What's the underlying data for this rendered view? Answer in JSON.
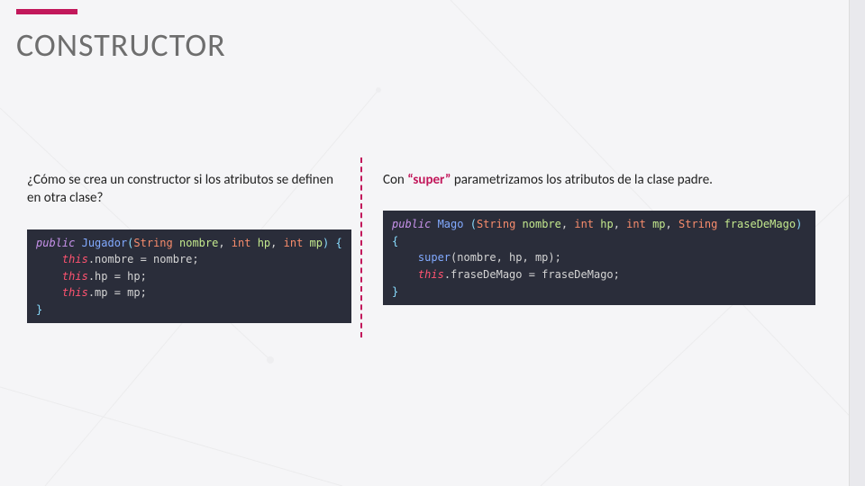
{
  "title": "CONSTRUCTOR",
  "left": {
    "question": "¿Cómo se crea un constructor si los atributos se definen en otra clase?",
    "code": {
      "l1_public": "public",
      "l1_name": "Jugador",
      "l1_sig_a": "(",
      "l1_t1": "String",
      "l1_p1": " nombre",
      "l1_c1": ", ",
      "l1_t2": "int",
      "l1_p2": " hp",
      "l1_c2": ", ",
      "l1_t3": "int",
      "l1_p3": " mp",
      "l1_sig_b": ")",
      "l1_brace": " {",
      "l2_this": "this",
      "l2_rest": ".nombre = nombre;",
      "l3_this": "this",
      "l3_rest": ".hp = hp;",
      "l4_this": "this",
      "l4_rest": ".mp = mp;",
      "l5": "}"
    }
  },
  "right": {
    "pre": "Con ",
    "super": "“super”",
    "post": " parametrizamos los atributos de la clase padre.",
    "code": {
      "l1_public": "public",
      "l1_name": " Mago ",
      "l1_open": "(",
      "l1_t1": "String",
      "l1_p1": " nombre",
      "l1_c1": ", ",
      "l1_t2": "int",
      "l1_p2": " hp",
      "l1_c2": ", ",
      "l1_t3": "int",
      "l1_p3": " mp",
      "l1_c3": ", ",
      "l1_t4": "String",
      "l1_p4": " fraseDeMago",
      "l1_close": ")",
      "l2": "{",
      "l3_super": "super",
      "l3_args": "(nombre, hp, mp);",
      "l4_this": "this",
      "l4_rest": ".fraseDeMago = fraseDeMago;",
      "l5": "}"
    }
  }
}
